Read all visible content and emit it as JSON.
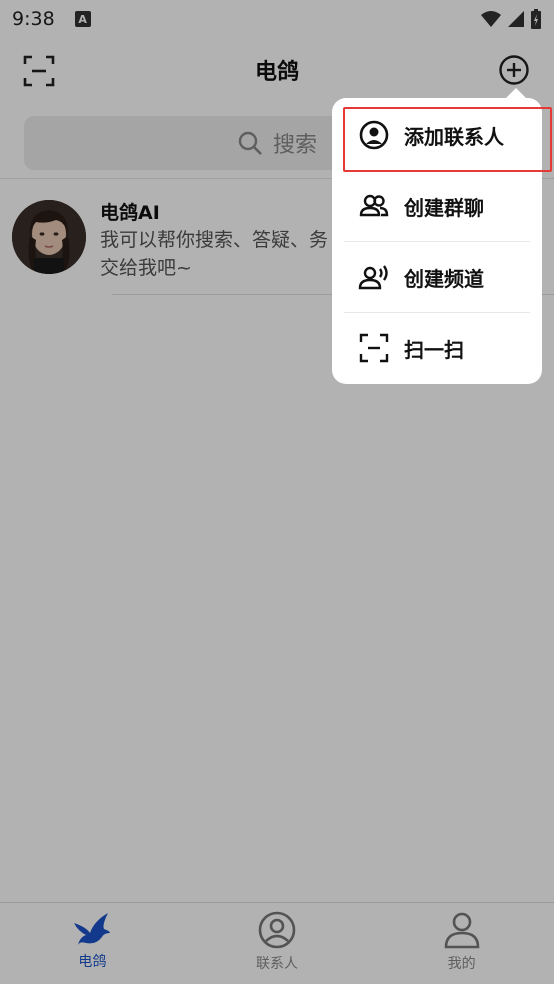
{
  "status_bar": {
    "time": "9:38",
    "notif_icon_letter": "A"
  },
  "header": {
    "title": "电鸽"
  },
  "search": {
    "placeholder": "搜索"
  },
  "chat_list": [
    {
      "name": "电鸽AI",
      "message": "我可以帮你搜索、答疑、务交给我吧~"
    }
  ],
  "popup_menu": {
    "items": [
      {
        "label": "添加联系人",
        "icon": "user-circle-icon"
      },
      {
        "label": "创建群聊",
        "icon": "group-icon"
      },
      {
        "label": "创建频道",
        "icon": "broadcast-user-icon"
      },
      {
        "label": "扫一扫",
        "icon": "scan-icon"
      }
    ]
  },
  "bottom_nav": {
    "items": [
      {
        "label": "电鸽",
        "icon": "pigeon-icon",
        "active": true
      },
      {
        "label": "联系人",
        "icon": "contacts-icon",
        "active": false
      },
      {
        "label": "我的",
        "icon": "profile-icon",
        "active": false
      }
    ]
  },
  "colors": {
    "accent": "#1a52c8",
    "highlight": "#e53935",
    "overlay": "rgba(0,0,0,0.30)"
  }
}
